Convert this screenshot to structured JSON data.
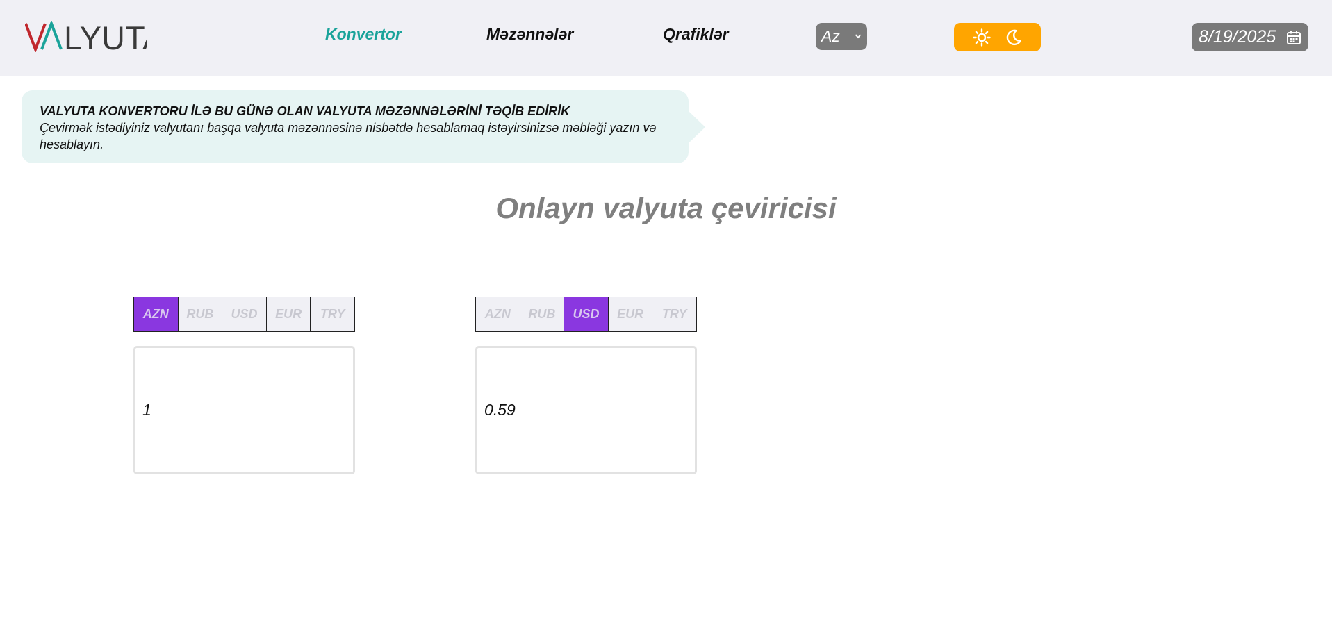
{
  "header": {
    "logo_text": "VALYUTA",
    "nav": {
      "konvertor": "Konvertor",
      "mezenneler": "Məzənnələr",
      "qrafikler": "Qrafiklər"
    },
    "language": {
      "selected": "Az"
    },
    "theme": {
      "light_icon": "sun-icon",
      "dark_icon": "moon-icon"
    },
    "date": "8/19/2025"
  },
  "info": {
    "title": "VALYUTA KONVERTORU İLƏ BU GÜNƏ OLAN VALYUTA MƏZƏNNƏLƏRİNİ TƏQİB EDİRİK",
    "text": "Çevirmək istədiyiniz valyutanı başqa valyuta məzənnəsinə nisbətdə hesablamaq istəyirsinizsə məbləği yazın və hesablayın."
  },
  "page_title": "Onlayn valyuta çeviricisi",
  "converter": {
    "currencies": [
      "AZN",
      "RUB",
      "USD",
      "EUR",
      "TRY"
    ],
    "from": {
      "selected": "AZN",
      "amount": "1"
    },
    "to": {
      "selected": "USD",
      "amount": "0.59"
    }
  },
  "colors": {
    "accent_teal": "#1aa39a",
    "active_tab": "#8a37e0",
    "theme_toggle": "#ffa500",
    "control_gray": "#7a7a7a",
    "header_bg": "#f0f0f5",
    "info_bg": "#e6f4f3"
  }
}
